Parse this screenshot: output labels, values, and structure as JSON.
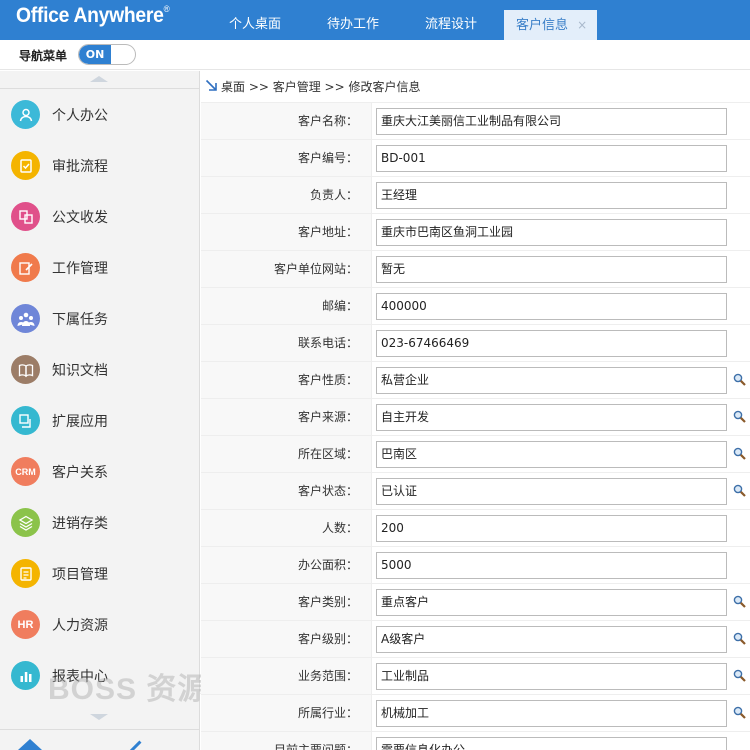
{
  "header": {
    "logo": "Office Anywhere",
    "logo_mark": "®",
    "tabs": [
      {
        "label": "个人桌面"
      },
      {
        "label": "待办工作"
      },
      {
        "label": "流程设计"
      },
      {
        "label": "客户信息",
        "close": "×"
      }
    ],
    "brand_color": "#2f80d1"
  },
  "navbar": {
    "label": "导航菜单",
    "toggle": "ON"
  },
  "sidebar": {
    "items": [
      {
        "label": "个人办公",
        "icon": "person-icon",
        "color": "#3cb9d8"
      },
      {
        "label": "审批流程",
        "icon": "approval-icon",
        "color": "#f4b400"
      },
      {
        "label": "公文收发",
        "icon": "document-exchange-icon",
        "color": "#e0508a"
      },
      {
        "label": "工作管理",
        "icon": "work-edit-icon",
        "color": "#f07a4b"
      },
      {
        "label": "下属任务",
        "icon": "team-icon",
        "color": "#6f86d8"
      },
      {
        "label": "知识文档",
        "icon": "book-icon",
        "color": "#9c7d67"
      },
      {
        "label": "扩展应用",
        "icon": "extension-icon",
        "color": "#35b8d0"
      },
      {
        "label": "客户关系",
        "icon": "crm-icon",
        "badge": "CRM",
        "color": "#f07d5e"
      },
      {
        "label": "进销存类",
        "icon": "inventory-icon",
        "color": "#8bc34a"
      },
      {
        "label": "项目管理",
        "icon": "project-icon",
        "color": "#f4b400"
      },
      {
        "label": "人力资源",
        "icon": "hr-icon",
        "badge": "HR",
        "color": "#f07d5e"
      },
      {
        "label": "报表中心",
        "icon": "report-chart-icon",
        "color": "#35b8d0"
      }
    ]
  },
  "watermark": "BOSS 资源",
  "breadcrumb": "桌面 >> 客户管理 >> 修改客户信息",
  "form": {
    "rows": [
      {
        "label": "客户名称：",
        "value": "重庆大江美丽信工业制品有限公司"
      },
      {
        "label": "客户编号：",
        "value": "BD-001"
      },
      {
        "label": "负责人：",
        "value": "王经理"
      },
      {
        "label": "客户地址：",
        "value": "重庆市巴南区鱼洞工业园"
      },
      {
        "label": "客户单位网站：",
        "value": "暂无"
      },
      {
        "label": "邮编：",
        "value": "400000"
      },
      {
        "label": "联系电话：",
        "value": "023-67466469"
      },
      {
        "label": "客户性质：",
        "value": "私营企业",
        "lookup": true
      },
      {
        "label": "客户来源：",
        "value": "自主开发",
        "lookup": true
      },
      {
        "label": "所在区域：",
        "value": "巴南区",
        "lookup": true
      },
      {
        "label": "客户状态：",
        "value": "已认证",
        "lookup": true
      },
      {
        "label": "人数：",
        "value": "200"
      },
      {
        "label": "办公面积：",
        "value": "5000"
      },
      {
        "label": "客户类别：",
        "value": "重点客户",
        "lookup": true
      },
      {
        "label": "客户级别：",
        "value": "A级客户",
        "lookup": true
      },
      {
        "label": "业务范围：",
        "value": "工业制品",
        "lookup": true
      },
      {
        "label": "所属行业：",
        "value": "机械加工",
        "lookup": true
      },
      {
        "label": "目前主要问题：",
        "value": "需要信息化办公"
      }
    ]
  }
}
